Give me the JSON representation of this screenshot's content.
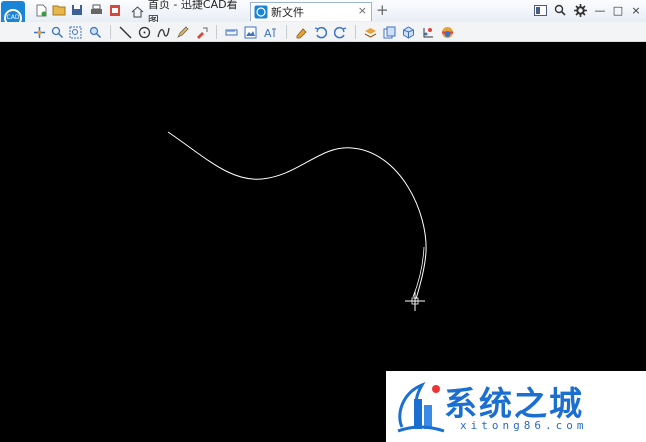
{
  "app": {
    "logo_text": "CAD"
  },
  "tabs": [
    {
      "label": "首页 - 迅捷CAD看图"
    },
    {
      "label": "新文件"
    }
  ],
  "tab_add": "+",
  "tab_close": "×",
  "window_controls": {
    "minimize": "—",
    "maximize": "□",
    "close": "×"
  },
  "watermark": {
    "title": "系统之城",
    "subtitle": "xitong86.com"
  },
  "colors": {
    "canvas": "#000000",
    "stroke": "#ffffff",
    "accent": "#1a84d7"
  }
}
